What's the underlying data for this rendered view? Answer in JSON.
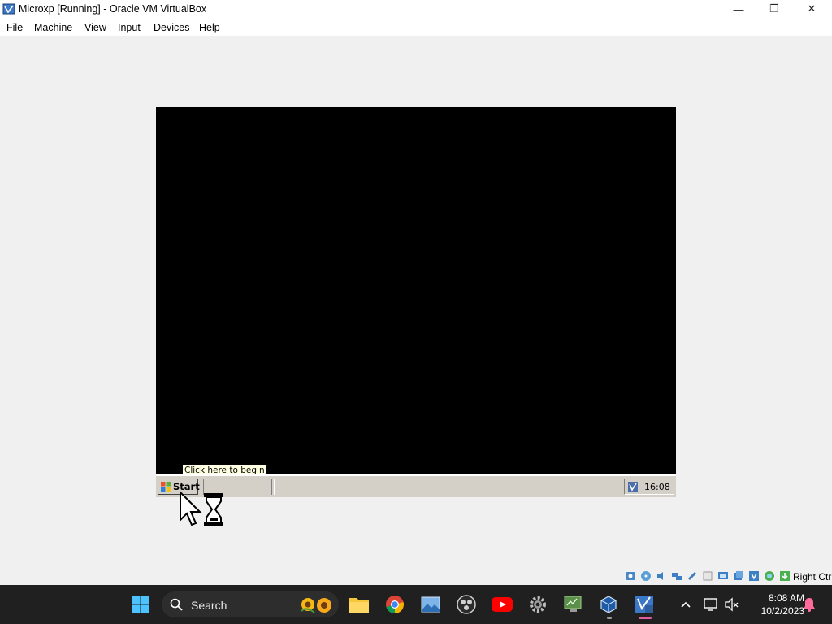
{
  "window": {
    "title": "Microxp [Running] - Oracle VM VirtualBox",
    "minimize_glyph": "—",
    "maximize_glyph": "❐",
    "close_glyph": "✕"
  },
  "menubar": {
    "items": [
      "File",
      "Machine",
      "View",
      "Input",
      "Devices",
      "Help"
    ]
  },
  "vm": {
    "taskbar": {
      "start_label": "Start",
      "clock": "16:08"
    },
    "tooltip": "Click here to begin"
  },
  "vbox_status": {
    "host_key": "Right Ctrl"
  },
  "host_taskbar": {
    "search_placeholder": "Search",
    "time": "8:08 AM",
    "date": "10/2/2023"
  },
  "colors": {
    "taskbar_bg": "#202020",
    "vm_background": "#000000",
    "xp_taskbar": "#d4d0c8",
    "tooltip_bg": "#ffffe1"
  }
}
